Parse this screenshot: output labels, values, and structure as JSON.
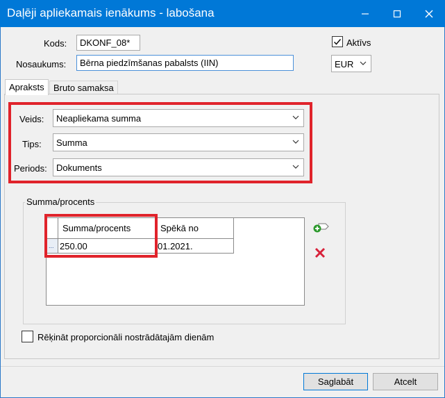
{
  "window": {
    "title": "Daļēji apliekamais ienākums - labošana"
  },
  "header": {
    "kods_label": "Kods:",
    "kods_value": "DKONF_08*",
    "nosaukums_label": "Nosaukums:",
    "nosaukums_value": "Bērna piedzīmšanas pabalsts (IIN)",
    "aktivs_label": "Aktīvs",
    "aktivs_checked": true,
    "currency_value": "EUR"
  },
  "tabs": [
    {
      "label": "Apraksts",
      "active": true
    },
    {
      "label": "Bruto samaksa",
      "active": false
    }
  ],
  "fields": {
    "veids_label": "Veids:",
    "veids_value": "Neapliekama summa",
    "tips_label": "Tips:",
    "tips_value": "Summa",
    "periods_label": "Periods:",
    "periods_value": "Dokuments"
  },
  "summa_group": {
    "title": "Summa/procents",
    "columns": [
      "Summa/procents",
      "Spēkā no"
    ],
    "rows": [
      {
        "selector": "...",
        "summa": "250.00",
        "speka_no": "01.2021."
      }
    ]
  },
  "proportional": {
    "label": "Rēķināt proporcionāli nostrādātajām dienām",
    "checked": false
  },
  "buttons": {
    "save": "Saglabāt",
    "cancel": "Atcelt"
  },
  "colors": {
    "titlebar": "#0078d7",
    "highlight": "#e0232b",
    "add_icon": "#2e9a2e",
    "delete_icon": "#d8213a"
  }
}
